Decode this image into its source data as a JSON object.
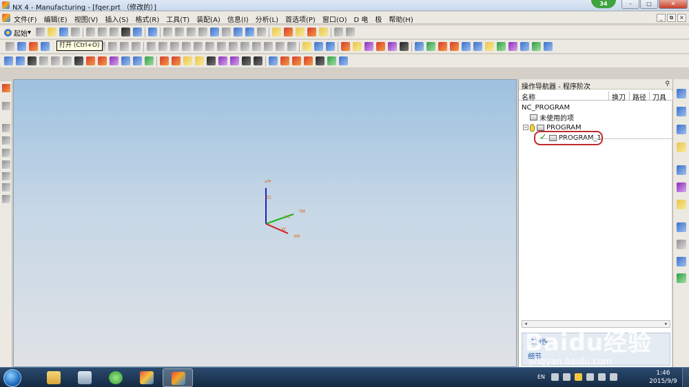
{
  "window": {
    "title": "NX 4 - Manufacturing - [fqer.prt （修改的）]",
    "notification_count": "34",
    "min_label": "–",
    "max_label": "□",
    "close_label": "✕"
  },
  "menu": {
    "items": [
      "文件(F)",
      "编辑(E)",
      "视图(V)",
      "插入(S)",
      "格式(R)",
      "工具(T)",
      "装配(A)",
      "信息(I)",
      "分析(L)",
      "首选项(P)",
      "窗口(O)",
      "D 电",
      "极",
      "帮助(H)"
    ],
    "mdi_buttons": [
      "_",
      "⧉",
      "×"
    ]
  },
  "toolbar": {
    "start_label": "起始",
    "tooltip": "打开 (Ctrl+O)"
  },
  "viewport": {
    "axes": {
      "zm": "ZM",
      "zc": "ZC",
      "ym": "YM",
      "yc": "YC",
      "xc": "XC",
      "xm": "XM"
    },
    "colors": {
      "z": "#1f1fb8",
      "y": "#18b818",
      "x": "#d01818",
      "label": "#e06010"
    }
  },
  "navigator": {
    "title": "操作导航器 - 程序阶次",
    "pin_icon": "pin-icon",
    "columns": [
      "名称",
      "换刀",
      "路径",
      "刀具"
    ],
    "tree": {
      "root": "NC_PROGRAM",
      "unused": "未使用的项",
      "program": "PROGRAM",
      "program_1": "PROGRAM_1"
    },
    "dependency_label": "依赖性",
    "details_label": "细节"
  },
  "watermark": {
    "logo": "Baidu经验",
    "url": "jingyan.baidu.com"
  },
  "taskbar": {
    "lang": "EN",
    "time": "1:46",
    "date": "2015/9/9"
  }
}
